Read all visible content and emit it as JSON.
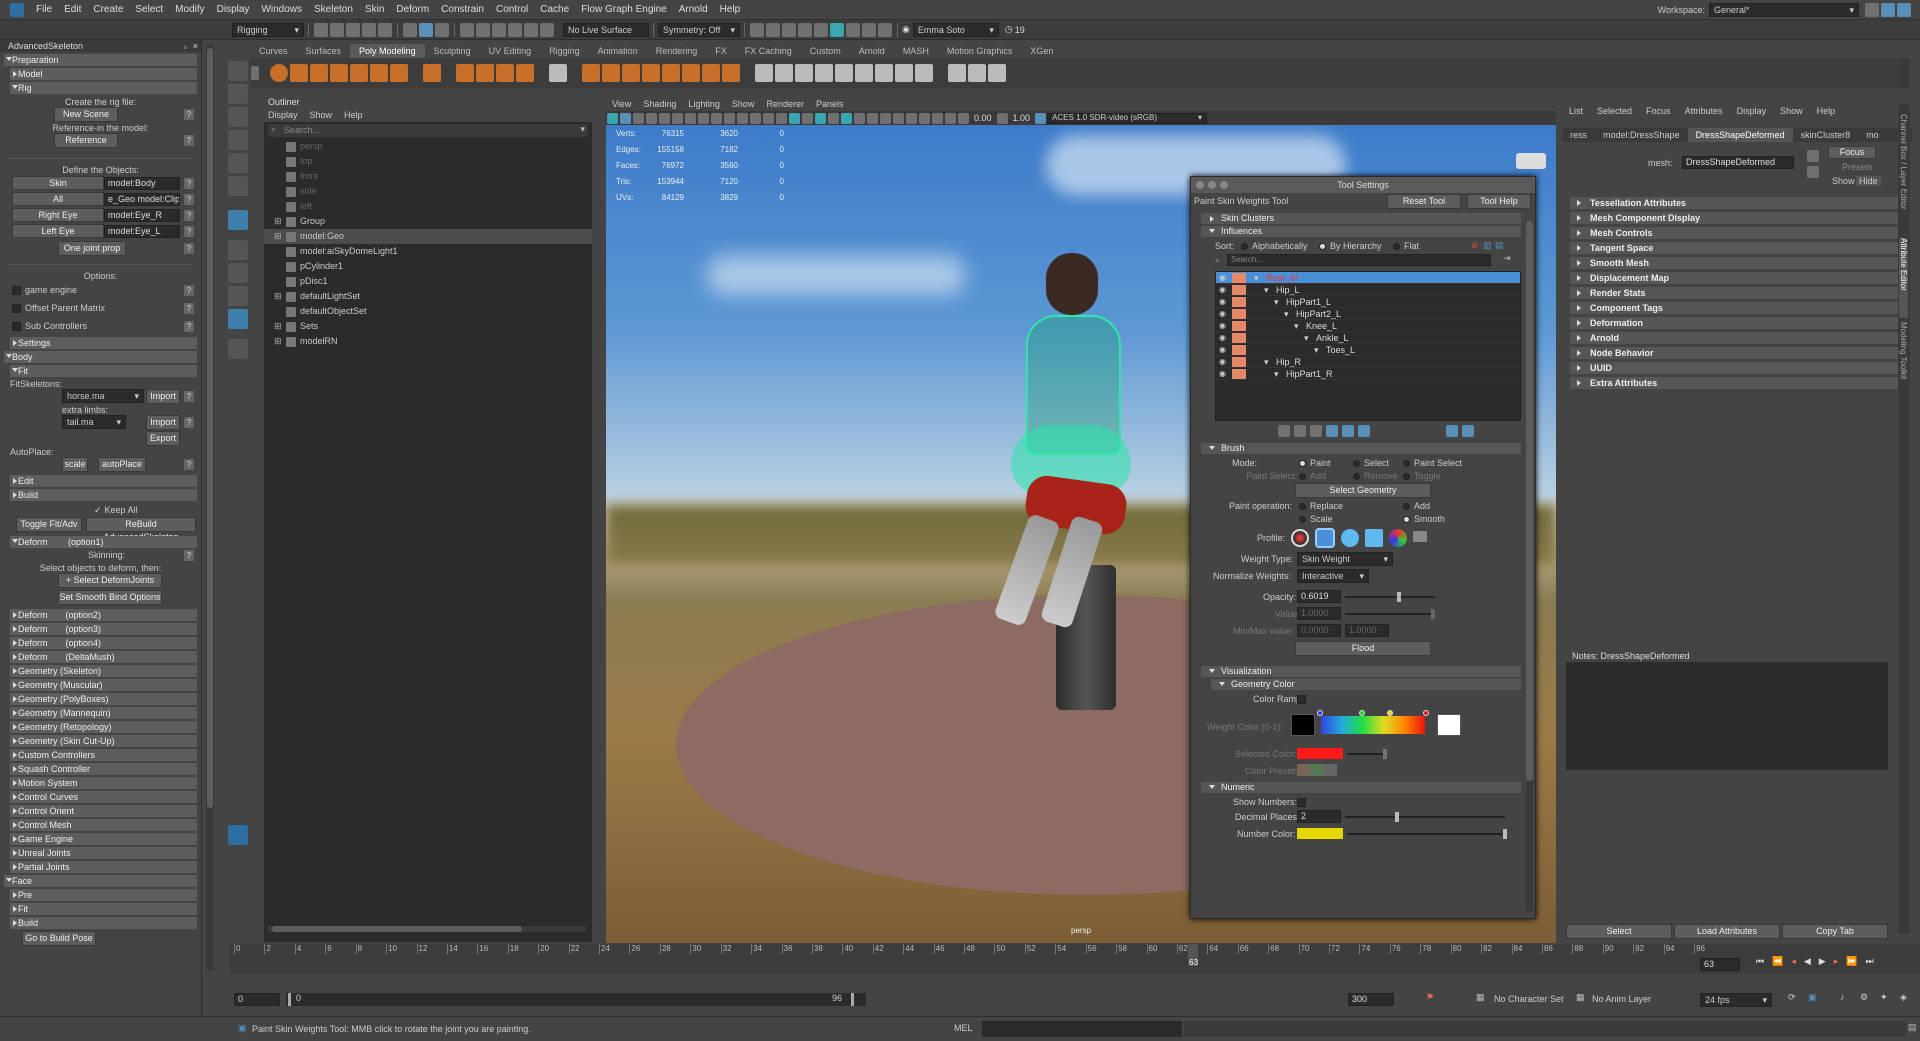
{
  "menu": [
    "File",
    "Edit",
    "Create",
    "Select",
    "Modify",
    "Display",
    "Windows",
    "Skeleton",
    "Skin",
    "Deform",
    "Constrain",
    "Control",
    "Cache",
    "Flow Graph Engine",
    "Arnold",
    "Help"
  ],
  "workspace": {
    "label": "Workspace:",
    "value": "General*"
  },
  "statusline": {
    "menuset": "Rigging",
    "live": "No Live Surface",
    "symmetry": "Symmetry: Off",
    "user": "Emma Soto",
    "notif": "19"
  },
  "shelf_tabs": [
    "Curves",
    "Surfaces",
    "Poly Modeling",
    "Sculpting",
    "UV Editing",
    "Rigging",
    "Animation",
    "Rendering",
    "FX",
    "FX Caching",
    "Custom",
    "Arnold",
    "MASH",
    "Motion Graphics",
    "XGen"
  ],
  "shelf_active": "Poly Modeling",
  "as": {
    "title": "AdvancedSkeleton",
    "preparation": "Preparation",
    "model": "Model",
    "rig": "Rig",
    "create_rig_label": "Create the rig file:",
    "new_scene": "New Scene",
    "reference_label": "Reference-in the model:",
    "reference": "Reference",
    "define_label": "Define the Objects:",
    "skin": "Skin",
    "skin_val": "model:Body",
    "all": "All",
    "all_val": "e_Geo model:Clip",
    "right_eye": "Right Eye",
    "right_eye_val": "model:Eye_R",
    "left_eye": "Left Eye",
    "left_eye_val": "model:Eye_L",
    "one_joint": "One joint prop",
    "options": "Options:",
    "opt1": "game engine",
    "opt2": "Offset Parent Matrix",
    "opt3": "Sub Controllers",
    "settings": "Settings",
    "body": "Body",
    "fit": "Fit",
    "fitskeletons": "FitSkeletons:",
    "horse": "horse.ma",
    "import": "Import",
    "extra": "extra limbs:",
    "tail": "tail.ma",
    "import2": "Import",
    "export": "Export",
    "autoplace": "AutoPlace:",
    "scale": "scale",
    "autoplace_btn": "autoPlace",
    "edit": "Edit",
    "build": "Build",
    "keep_all": "Keep All",
    "toggle": "Toggle Fit/Adv",
    "rebuild": "ReBuild AdvancedSkeleton",
    "deform1": "Deform",
    "deform1_opt": "(option1)",
    "skinning": "Skinning:",
    "select_objs": "Select objects to deform, then:",
    "select_deform": "+ Select DeformJoints",
    "smooth_bind": "Set Smooth Bind Options",
    "sections": [
      [
        "Deform",
        "(option2)"
      ],
      [
        "Deform",
        "(option3)"
      ],
      [
        "Deform",
        "(option4)"
      ],
      [
        "Deform",
        "(DeltaMush)"
      ],
      [
        "Geometry (Skeleton)",
        ""
      ],
      [
        "Geometry (Muscular)",
        ""
      ],
      [
        "Geometry (PolyBoxes)",
        ""
      ],
      [
        "Geometry (Mannequin)",
        ""
      ],
      [
        "Geometry (Retopology)",
        ""
      ],
      [
        "Geometry (Skin Cut-Up)",
        ""
      ],
      [
        "Custom Controllers",
        ""
      ],
      [
        "Squash Controller",
        ""
      ],
      [
        "Motion System",
        ""
      ],
      [
        "Control Curves",
        ""
      ],
      [
        "Control Orient",
        ""
      ],
      [
        "Control Mesh",
        ""
      ],
      [
        "Game Engine",
        ""
      ],
      [
        "Unreal Joints",
        ""
      ],
      [
        "Partial Joints",
        ""
      ]
    ],
    "face": "Face",
    "pre": "Pre",
    "fit2": "Fit",
    "build2": "Build",
    "goto": "Go to Build Pose"
  },
  "outliner": {
    "title": "Outliner",
    "menu": [
      "Display",
      "Show",
      "Help"
    ],
    "search": "Search...",
    "items": [
      {
        "label": "persp",
        "dim": true,
        "indent": 0
      },
      {
        "label": "top",
        "dim": true,
        "indent": 0
      },
      {
        "label": "front",
        "dim": true,
        "indent": 0
      },
      {
        "label": "side",
        "dim": true,
        "indent": 0
      },
      {
        "label": "left",
        "dim": true,
        "indent": 0
      },
      {
        "label": "Group",
        "dim": false,
        "indent": 0,
        "plus": true
      },
      {
        "label": "model:Geo",
        "dim": false,
        "indent": 0,
        "plus": true,
        "sel": true
      },
      {
        "label": "model:aiSkyDomeLight1",
        "dim": false,
        "indent": 0
      },
      {
        "label": "pCylinder1",
        "dim": false,
        "indent": 0
      },
      {
        "label": "pDisc1",
        "dim": false,
        "indent": 0
      },
      {
        "label": "defaultLightSet",
        "dim": false,
        "indent": 0,
        "plus": true
      },
      {
        "label": "defaultObjectSet",
        "dim": false,
        "indent": 0
      },
      {
        "label": "Sets",
        "dim": false,
        "indent": 0,
        "plus": true
      },
      {
        "label": "modelRN",
        "dim": false,
        "indent": 0,
        "plus": true
      }
    ]
  },
  "viewport": {
    "menu": [
      "View",
      "Shading",
      "Lighting",
      "Show",
      "Renderer",
      "Panels"
    ],
    "exposure": "0.00",
    "gamma": "1.00",
    "colorspace": "ACES 1.0 SDR-video (sRGB)",
    "hud": [
      [
        "Verts:",
        "76315",
        "3620",
        "0"
      ],
      [
        "Edges:",
        "155158",
        "7182",
        "0"
      ],
      [
        "Faces:",
        "76972",
        "3560",
        "0"
      ],
      [
        "Tris:",
        "153944",
        "7120",
        "0"
      ],
      [
        "UVs:",
        "84129",
        "3829",
        "0"
      ]
    ],
    "camera": "persp"
  },
  "tool": {
    "title": "Tool Settings",
    "name": "Paint Skin Weights Tool",
    "reset": "Reset Tool",
    "help": "Tool Help",
    "skin_clusters": "Skin Clusters",
    "influences": "Influences",
    "sort": "Sort:",
    "alpha": "Alphabetically",
    "hier": "By Hierarchy",
    "flat": "Flat",
    "search": "Search...",
    "joints": [
      [
        "Root_M",
        0,
        true
      ],
      [
        "Hip_L",
        1,
        false
      ],
      [
        "HipPart1_L",
        2,
        false
      ],
      [
        "HipPart2_L",
        3,
        false
      ],
      [
        "Knee_L",
        4,
        false
      ],
      [
        "Ankle_L",
        5,
        false
      ],
      [
        "Toes_L",
        6,
        false
      ],
      [
        "Hip_R",
        1,
        false
      ],
      [
        "HipPart1_R",
        2,
        false
      ]
    ],
    "brush": "Brush",
    "mode": "Mode:",
    "paint": "Paint",
    "select": "Select",
    "paint_select": "Paint Select",
    "paint_sel": "Paint Select:",
    "add": "Add",
    "remove": "Remove",
    "toggle": "Toggle",
    "select_geo": "Select Geometry",
    "paint_op": "Paint operation:",
    "replace": "Replace",
    "add2": "Add",
    "scale": "Scale",
    "smooth": "Smooth",
    "profile": "Profile:",
    "weight_type": "Weight Type:",
    "weight_type_val": "Skin Weight",
    "normalize": "Normalize Weights:",
    "normalize_val": "Interactive",
    "opacity": "Opacity:",
    "opacity_val": "0.6019",
    "value": "Value:",
    "value_val": "1.0000",
    "minmax": "Min/Max value:",
    "min_val": "0.0000",
    "max_val": "1.0000",
    "flood": "Flood",
    "visualization": "Visualization",
    "geo_color": "Geometry Color",
    "color_ramp": "Color Ramp:",
    "weight_color": "Weight Color (0-1):",
    "selected_color": "Selected Color:",
    "color_presets": "Color Presets:",
    "numeric": "Numeric",
    "show_numbers": "Show Numbers:",
    "decimal": "Decimal Places:",
    "decimal_val": "2",
    "number_color": "Number Color:",
    "colors": {
      "selected": "#ff1a1a",
      "number": "#e8d800",
      "accent": "#4a90d9",
      "joint": "#e3896a"
    }
  },
  "ae": {
    "menu": [
      "List",
      "Selected",
      "Focus",
      "Attributes",
      "Display",
      "Show",
      "Help"
    ],
    "tabs": [
      "ress",
      "model:DressShape",
      "DressShapeDeformed",
      "skinCluster8",
      "mo"
    ],
    "mesh_label": "mesh:",
    "mesh_val": "DressShapeDeformed",
    "focus": "Focus",
    "presets": "Presets",
    "show": "Show",
    "hide": "Hide",
    "sections": [
      "Tessellation Attributes",
      "Mesh Component Display",
      "Mesh Controls",
      "Tangent Space",
      "Smooth Mesh",
      "Displacement Map",
      "Render Stats",
      "Component Tags",
      "Deformation",
      "Arnold",
      "Node Behavior",
      "UUID",
      "Extra Attributes"
    ],
    "notes": "Notes: DressShapeDeformed",
    "select": "Select",
    "load": "Load Attributes",
    "copy": "Copy Tab",
    "side_tabs": [
      "Channel Box / Layer Editor",
      "Attribute Editor",
      "Modeling Toolkit"
    ]
  },
  "timeline": {
    "ticks": [
      "0",
      "2",
      "4",
      "6",
      "8",
      "10",
      "12",
      "14",
      "16",
      "18",
      "20",
      "22",
      "24",
      "26",
      "28",
      "30",
      "32",
      "34",
      "36",
      "38",
      "40",
      "42",
      "44",
      "46",
      "48",
      "50",
      "52",
      "54",
      "56",
      "58",
      "60",
      "62",
      "64",
      "66",
      "68",
      "70",
      "72",
      "74",
      "76",
      "78",
      "80",
      "82",
      "84",
      "86",
      "88",
      "90",
      "92",
      "94",
      "96"
    ],
    "current": "63",
    "frame_field": "63",
    "start": "0",
    "start2": "0",
    "end_mid": "96",
    "end": "300",
    "charset": "No Character Set",
    "animlayer": "No Anim Layer",
    "fps": "24 fps"
  },
  "cmd": {
    "help": "Paint Skin Weights Tool: MMB click to rotate the joint you are painting.",
    "mel": "MEL"
  }
}
